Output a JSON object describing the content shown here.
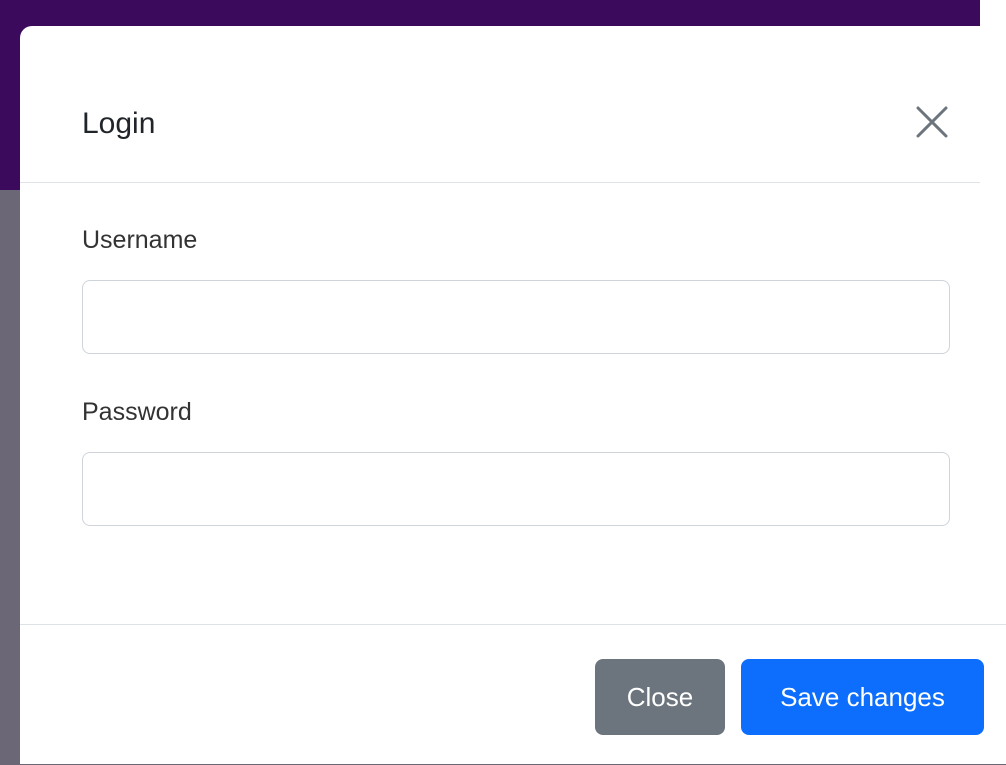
{
  "modal": {
    "title": "Login",
    "close_icon": "close-icon",
    "fields": {
      "username": {
        "label": "Username",
        "value": "",
        "placeholder": ""
      },
      "password": {
        "label": "Password",
        "value": "",
        "placeholder": ""
      }
    },
    "footer": {
      "close_label": "Close",
      "save_label": "Save changes"
    }
  },
  "colors": {
    "primary": "#0d6efd",
    "secondary": "#6c757d",
    "backdrop_header": "#3c0a5c",
    "marker": "#ff0000"
  }
}
